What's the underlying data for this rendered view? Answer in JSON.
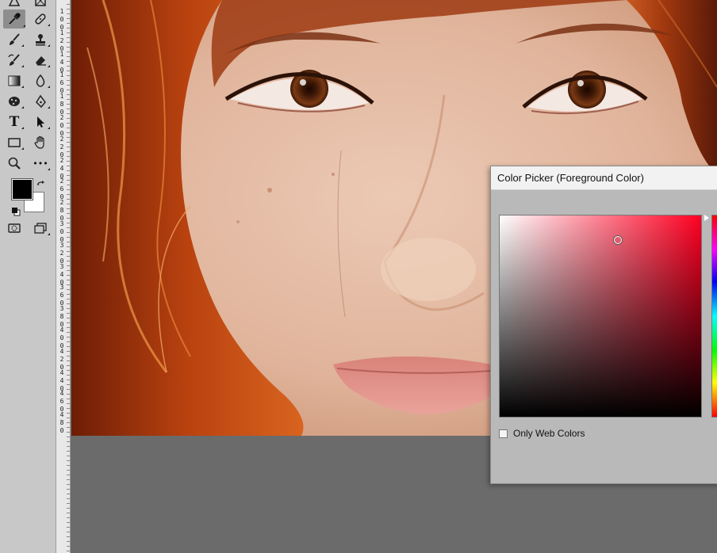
{
  "toolbar": {
    "tools": [
      {
        "name": "pen-tool",
        "icon": "pen-icon"
      },
      {
        "name": "frame-tool",
        "icon": "frame-icon"
      },
      {
        "name": "eyedropper-tool",
        "icon": "eyedropper-icon",
        "active": true
      },
      {
        "name": "healing-brush-tool",
        "icon": "bandage-icon"
      },
      {
        "name": "brush-tool",
        "icon": "brush-icon"
      },
      {
        "name": "clone-stamp-tool",
        "icon": "stamp-icon"
      },
      {
        "name": "history-brush-tool",
        "icon": "history-brush-icon"
      },
      {
        "name": "eraser-tool",
        "icon": "eraser-icon"
      },
      {
        "name": "gradient-tool",
        "icon": "gradient-icon"
      },
      {
        "name": "blur-tool",
        "icon": "drop-icon"
      },
      {
        "name": "sponge-tool",
        "icon": "sponge-icon"
      },
      {
        "name": "pen-path-tool",
        "icon": "pen-nib-icon"
      },
      {
        "name": "type-tool",
        "icon": "type-icon",
        "label": "T"
      },
      {
        "name": "path-selection-tool",
        "icon": "arrow-icon"
      },
      {
        "name": "rectangle-tool",
        "icon": "rectangle-icon"
      },
      {
        "name": "hand-tool",
        "icon": "hand-icon"
      },
      {
        "name": "zoom-tool",
        "icon": "zoom-icon"
      },
      {
        "name": "more-tools",
        "icon": "ellipsis-icon",
        "label": "•••"
      },
      {
        "name": "quick-mask",
        "icon": "quick-mask-icon"
      },
      {
        "name": "screen-mode",
        "icon": "screen-mode-icon"
      }
    ],
    "foreground_color": "#000000",
    "background_color": "#ffffff"
  },
  "ruler": {
    "labels": [
      "1 0 0",
      "1 2 0",
      "1 4 0",
      "1 6 0",
      "1 8 0",
      "2 0 0",
      "2 2 0",
      "2 4 0",
      "2 6 0",
      "2 8 0",
      "3 0 0",
      "3 2 0",
      "3 4 0",
      "3 6 0",
      "3 8 0",
      "4 0 0",
      "4 2 0",
      "4 4 0",
      "4 6 0",
      "4 8 0"
    ]
  },
  "color_picker": {
    "title": "Color Picker (Foreground Color)",
    "only_web_colors_label": "Only Web Colors",
    "only_web_colors_checked": false,
    "hue_color": "#ff0022"
  }
}
